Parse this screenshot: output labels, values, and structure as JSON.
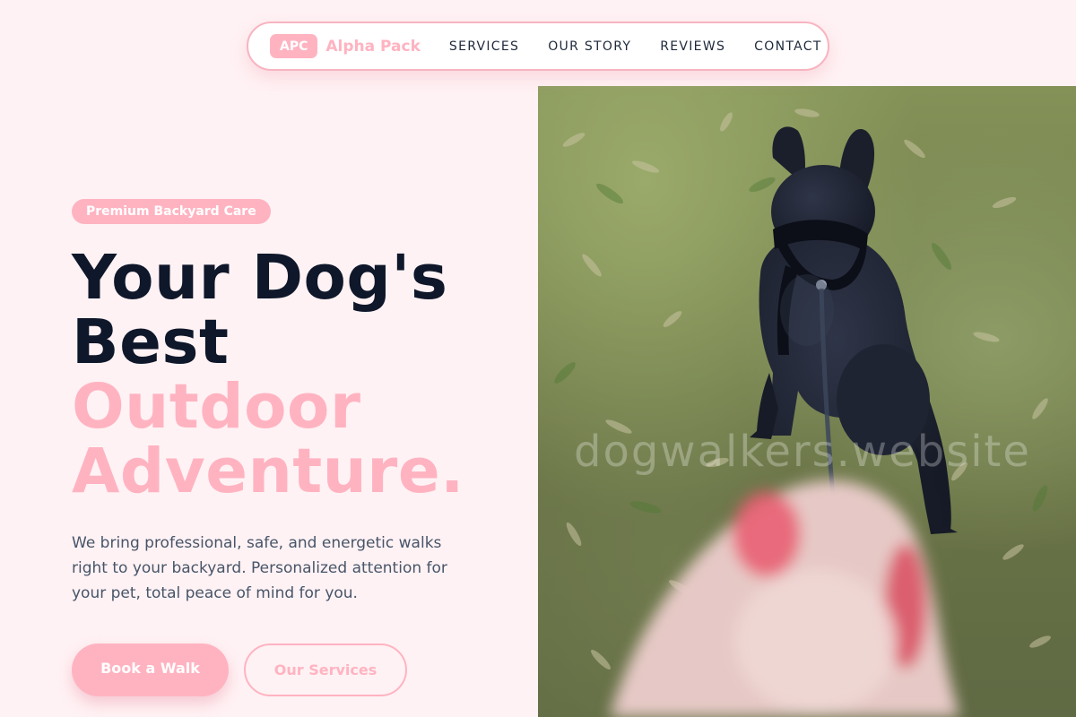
{
  "brand": {
    "badge": "APC",
    "name": "Alpha Pack"
  },
  "nav": {
    "links": [
      "SERVICES",
      "OUR STORY",
      "REVIEWS",
      "CONTACT"
    ]
  },
  "hero": {
    "tag": "Premium Backyard Care",
    "headline_line1": "Your Dog's",
    "headline_line2": "Best",
    "headline_line3": "Outdoor",
    "headline_line4": "Adventure.",
    "lead": "We bring professional, safe, and energetic walks right to your backyard. Personalized attention for your pet, total peace of mind for you.",
    "primary_cta": "Book a Walk",
    "secondary_cta": "Our Services"
  },
  "photo": {
    "watermark": "dogwalkers.website"
  },
  "colors": {
    "accent": "#ffb3c1",
    "background": "#fff2f4",
    "heading": "#0f172a",
    "body_text": "#475569"
  }
}
